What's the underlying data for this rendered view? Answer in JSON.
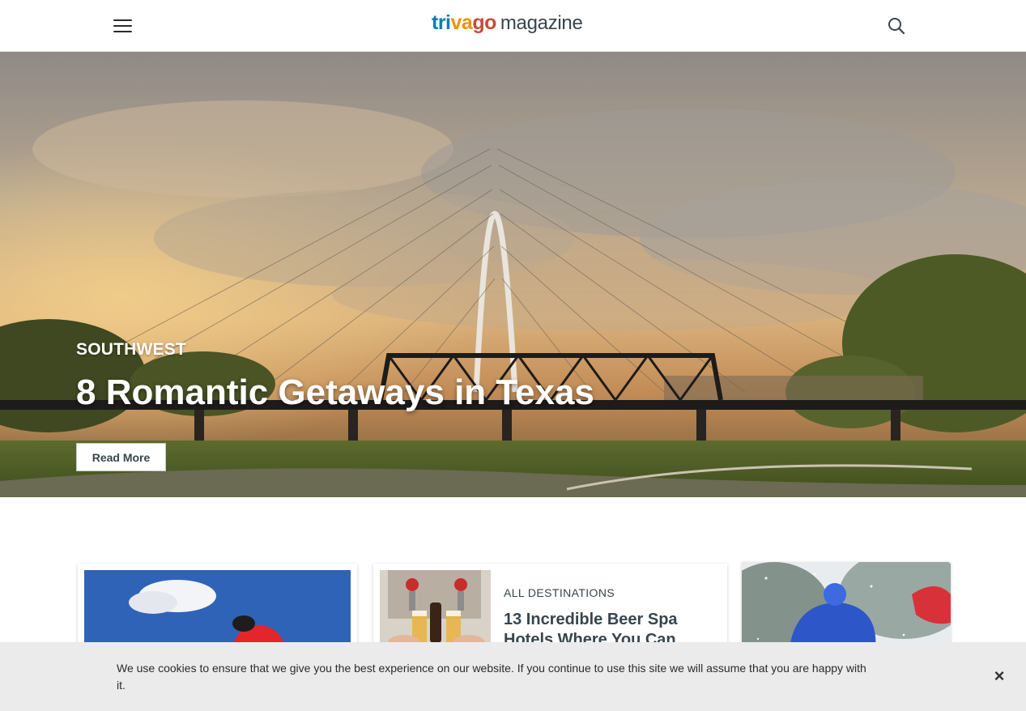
{
  "header": {
    "logo_part1": "tri",
    "logo_part2": "va",
    "logo_part3": "go",
    "logo_magazine": "magazine",
    "menu_icon": "hamburger-menu-icon",
    "search_icon": "search-icon"
  },
  "hero": {
    "category": "SOUTHWEST",
    "title": "8 Romantic Getaways in Texas",
    "read_more": "Read More"
  },
  "cards": [
    {
      "category": "",
      "title": ""
    },
    {
      "category": "ALL DESTINATIONS",
      "title": "13 Incredible Beer Spa Hotels Where You Can"
    },
    {
      "category": "",
      "title": ""
    }
  ],
  "cookie": {
    "text": "We use cookies to ensure that we give you the best experience on our website. If you continue to use this site we will assume that you are happy with it.",
    "close_icon": "close-icon",
    "close_label": "×"
  },
  "colors": {
    "brand_blue": "#007faf",
    "brand_orange": "#f48f00",
    "brand_red": "#c94a38",
    "text_dark": "#37454d",
    "cookie_bg": "#ebebeb"
  }
}
